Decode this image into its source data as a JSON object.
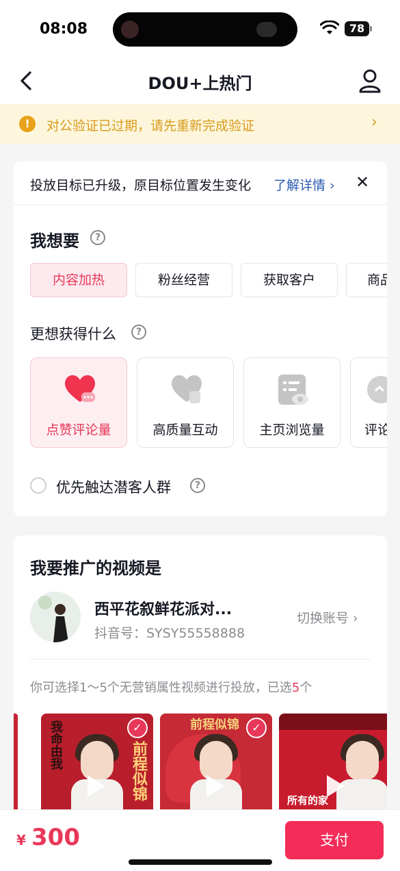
{
  "status_bar": {
    "time": "08:08",
    "battery": "78"
  },
  "nav": {
    "title": "DOU+上热门"
  },
  "warning": {
    "text": "对公验证已过期，请先重新完成验证",
    "arrow": "›"
  },
  "notice": {
    "text": "投放目标已升级，原目标位置发生变化",
    "link": "了解详情 ›",
    "close": "✕"
  },
  "want": {
    "title": "我想要",
    "help": "?",
    "options": [
      {
        "label": "内容加热",
        "active": true
      },
      {
        "label": "粉丝经营",
        "active": false
      },
      {
        "label": "获取客户",
        "active": false
      },
      {
        "label": "商品",
        "active": false
      }
    ]
  },
  "goals": {
    "title": "更想获得什么",
    "help": "?",
    "items": [
      {
        "label": "点赞评论量",
        "icon": "heart-chat-icon",
        "active": true
      },
      {
        "label": "高质量互动",
        "icon": "heart-hand-icon",
        "active": false
      },
      {
        "label": "主页浏览量",
        "icon": "profile-card-icon",
        "active": false
      },
      {
        "label": "评论",
        "icon": "comment-icon",
        "active": false
      }
    ]
  },
  "priority": {
    "label": "优先触达潜客人群",
    "help": "?",
    "checked": false
  },
  "promote": {
    "title": "我要推广的视频是",
    "account_name": "西平花叙鲜花派对...",
    "account_id": "抖音号：SYSY55558888",
    "switch_label": "切换账号 ›",
    "hint_prefix": "你可选择1～5个无营销属性视频进行投放，已选",
    "hint_count": "5",
    "hint_suffix": "个",
    "videos": [
      {
        "caption": "前程似锦",
        "checked": true
      },
      {
        "caption": "前程似锦",
        "checked": true
      },
      {
        "caption": "所有的家",
        "checked": false
      }
    ]
  },
  "footer": {
    "currency": "¥",
    "price": "300",
    "pay_label": "支付"
  },
  "colors": {
    "accent": "#f42d58",
    "warning": "#d99a1d",
    "link": "#2c5bb0"
  }
}
